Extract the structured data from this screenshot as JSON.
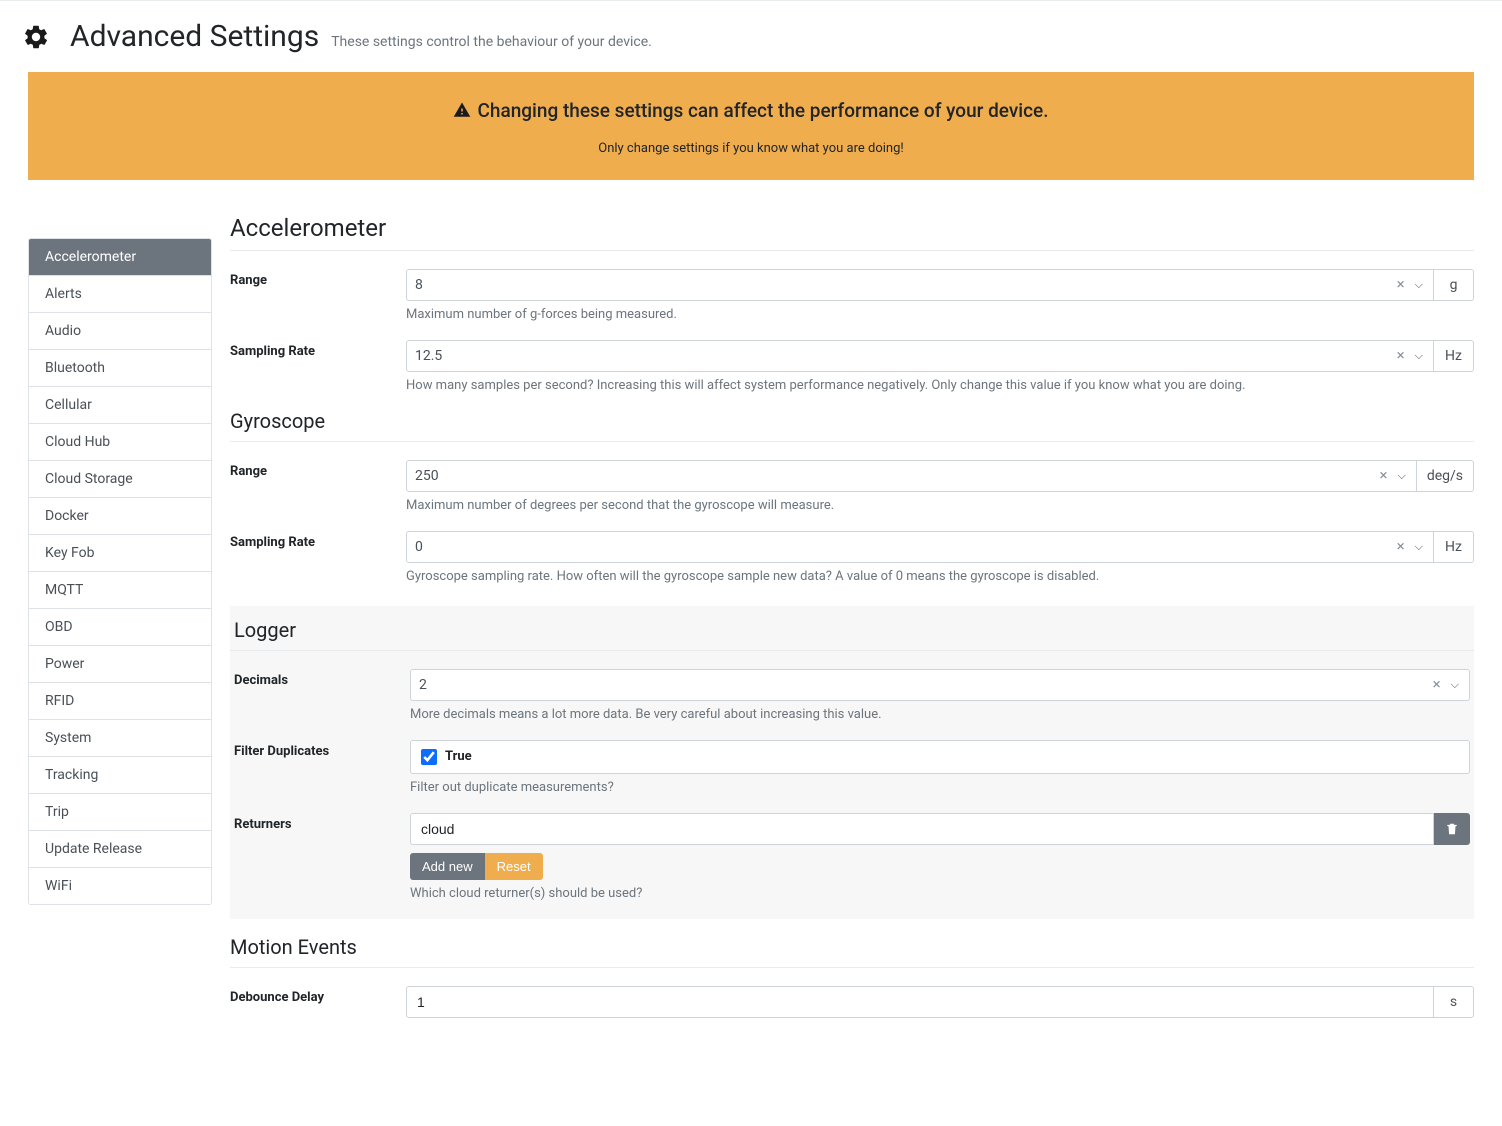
{
  "header": {
    "title": "Advanced Settings",
    "subtitle": "These settings control the behaviour of your device."
  },
  "alert": {
    "title": "Changing these settings can affect the performance of your device.",
    "sub": "Only change settings if you know what you are doing!"
  },
  "sidebar": {
    "items": [
      {
        "label": "Accelerometer",
        "active": true
      },
      {
        "label": "Alerts"
      },
      {
        "label": "Audio"
      },
      {
        "label": "Bluetooth"
      },
      {
        "label": "Cellular"
      },
      {
        "label": "Cloud Hub"
      },
      {
        "label": "Cloud Storage"
      },
      {
        "label": "Docker"
      },
      {
        "label": "Key Fob"
      },
      {
        "label": "MQTT"
      },
      {
        "label": "OBD"
      },
      {
        "label": "Power"
      },
      {
        "label": "RFID"
      },
      {
        "label": "System"
      },
      {
        "label": "Tracking"
      },
      {
        "label": "Trip"
      },
      {
        "label": "Update Release"
      },
      {
        "label": "WiFi"
      }
    ]
  },
  "sections": {
    "accel": {
      "heading": "Accelerometer",
      "range": {
        "label": "Range",
        "value": "8",
        "unit": "g",
        "help": "Maximum number of g-forces being measured."
      },
      "rate": {
        "label": "Sampling Rate",
        "value": "12.5",
        "unit": "Hz",
        "help": "How many samples per second? Increasing this will affect system performance negatively. Only change this value if you know what you are doing."
      }
    },
    "gyro": {
      "heading": "Gyroscope",
      "range": {
        "label": "Range",
        "value": "250",
        "unit": "deg/s",
        "help": "Maximum number of degrees per second that the gyroscope will measure."
      },
      "rate": {
        "label": "Sampling Rate",
        "value": "0",
        "unit": "Hz",
        "help": "Gyroscope sampling rate. How often will the gyroscope sample new data? A value of 0 means the gyroscope is disabled."
      }
    },
    "logger": {
      "heading": "Logger",
      "decimals": {
        "label": "Decimals",
        "value": "2",
        "help": "More decimals means a lot more data. Be very careful about increasing this value."
      },
      "filter": {
        "label": "Filter Duplicates",
        "checked": true,
        "text": "True",
        "help": "Filter out duplicate measurements?"
      },
      "returners": {
        "label": "Returners",
        "value": "cloud",
        "addnew": "Add new",
        "reset": "Reset",
        "help": "Which cloud returner(s) should be used?"
      }
    },
    "motion": {
      "heading": "Motion Events",
      "debounce": {
        "label": "Debounce Delay",
        "value": "1",
        "unit": "s"
      }
    }
  }
}
